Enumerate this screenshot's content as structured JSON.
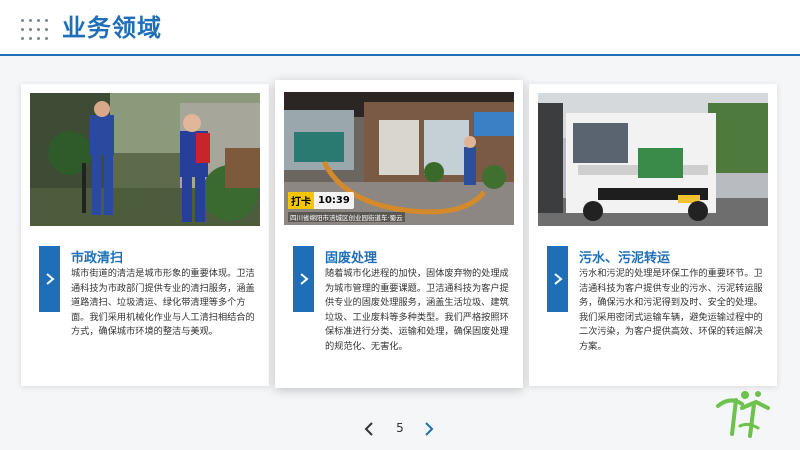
{
  "header": {
    "title": "业务领域"
  },
  "cards": [
    {
      "title": "市政清扫",
      "body": "城市街道的清洁是城市形象的重要体现。卫洁通科技为市政部门提供专业的清扫服务，涵盖道路清扫、垃圾清运、绿化带清理等多个方面。我们采用机械化作业与人工清扫相结合的方式，确保城市环境的整洁与美观。"
    },
    {
      "title": "固废处理",
      "body": "随着城市化进程的加快，固体废弃物的处理成为城市管理的重要课题。卫洁通科技为客户提供专业的固废处理服务，涵盖生活垃圾、建筑垃圾、工业废料等多种类型。我们严格按照环保标准进行分类、运输和处理，确保固废处理的规范化、无害化。",
      "overlay_tag": "打卡",
      "overlay_time": "10:39",
      "overlay_caption": "四川省绵阳市涪城区创业园街道车·蜀云"
    },
    {
      "title": "污水、污泥转运",
      "body": "污水和污泥的处理是环保工作的重要环节。卫洁通科技为客户提供专业的污水、污泥转运服务，确保污水和污泥得到及时、安全的处理。我们采用密闭式运输车辆，避免运输过程中的二次污染，为客户提供高效、环保的转运解决方案。"
    }
  ],
  "pager": {
    "page": "5"
  },
  "colors": {
    "brand": "#1f6fb8",
    "logo_green": "#6cc24a"
  },
  "icons": {
    "card_arrow": "chevron-right-icon",
    "prev": "chevron-left-icon",
    "next": "chevron-right-icon"
  }
}
